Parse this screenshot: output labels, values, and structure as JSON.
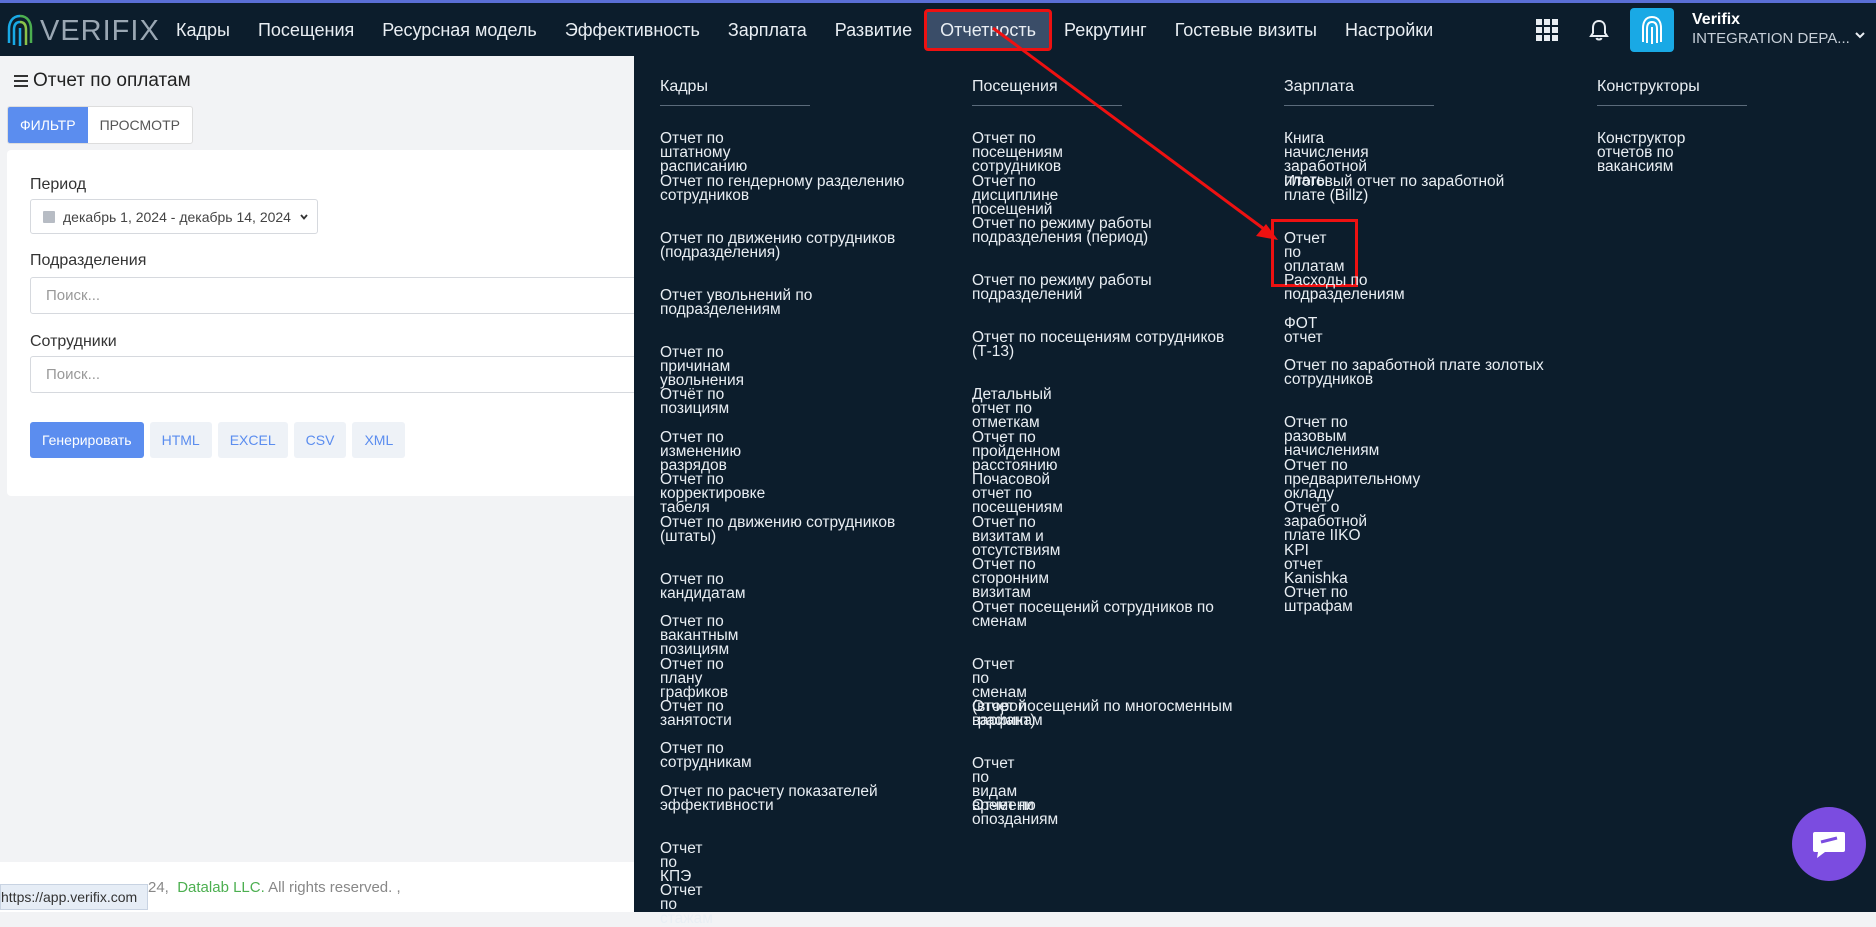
{
  "brand": {
    "logo_text": "VERIFIX"
  },
  "nav": [
    {
      "label": "Кадры"
    },
    {
      "label": "Посещения"
    },
    {
      "label": "Ресурсная модель"
    },
    {
      "label": "Эффективность"
    },
    {
      "label": "Зарплата"
    },
    {
      "label": "Развитие"
    },
    {
      "label": "Отчетность"
    },
    {
      "label": "Рекрутинг"
    },
    {
      "label": "Гостевые визиты"
    },
    {
      "label": "Настройки"
    }
  ],
  "user": {
    "name": "Verifix",
    "org": "INTEGRATION DEPA..."
  },
  "page": {
    "title": "Отчет по оплатам",
    "tabs": [
      {
        "label": "ФИЛЬТР"
      },
      {
        "label": "ПРОСМОТР"
      }
    ],
    "period_label": "Период",
    "period_value": "декабрь 1, 2024 - декабрь 14, 2024",
    "divisions_label": "Подразделения",
    "divisions_placeholder": "Поиск...",
    "employees_label": "Сотрудники",
    "employees_placeholder": "Поиск...",
    "buttons": [
      {
        "label": "Генерировать"
      },
      {
        "label": "HTML"
      },
      {
        "label": "EXCEL"
      },
      {
        "label": "CSV"
      },
      {
        "label": "XML"
      }
    ]
  },
  "footer": {
    "prefix": "24,",
    "company": "Datalab LLC.",
    "suffix": "All rights reserved. ,"
  },
  "status_url": "https://app.verifix.com",
  "menu": {
    "cadres": {
      "title": "Кадры",
      "items": [
        "Отчет по штатному расписанию",
        "Отчет по гендерному разделению сотрудников",
        "Отчет по движению сотрудников (подразделения)",
        "Отчет увольнений по подразделениям",
        "Отчет по причинам увольнения",
        "Отчёт по позициям",
        "Отчет по изменению разрядов",
        "Отчет по корректировке табеля",
        "Отчет по движению сотрудников (штаты)",
        "Отчет по кандидатам",
        "Отчет по вакантным позициям",
        "Отчет по плану графиков",
        "Отчет по занятости",
        "Отчет по сотрудникам",
        "Отчет по расчету показателей эффективности",
        "Отчет по КПЭ",
        "Отчет по стажам"
      ]
    },
    "visits": {
      "title": "Посещения",
      "items": [
        "Отчет по посещениям сотрудников",
        "Отчет по дисциплине посещений",
        "Отчет по режиму работы подразделения (период)",
        "Отчет по режиму работы подразделений",
        "Отчет по посещениям сотрудников (Т-13)",
        "Детальный отчет по отметкам",
        "Отчет по пройденном расстоянию",
        "Почасовой отчет по посещениям",
        "Отчет по визитам и отсутствиям",
        "Отчет по сторонним визитам",
        "Отчет посещений сотрудников по сменам",
        "Отчет по сменам (второй вариант)",
        "Отчет посещений по многосменным графикам",
        "Отчет по видам времени",
        "Отчет по опозданиям"
      ]
    },
    "salary": {
      "title": "Зарплата",
      "items": [
        "Книга начисления заработной платы",
        "Итоговый отчет по заработной плате (Billz)",
        "Отчет по оплатам",
        "Расходы по подразделениям",
        "ФОТ отчет",
        "Отчет по заработной плате золотых сотрудников",
        "Отчет по разовым начислениям",
        "Отчет по предварительному окладу",
        "Отчет о заработной плате IIKO",
        "KPI отчет Kanishka",
        "Отчет по штрафам"
      ]
    },
    "constructors": {
      "title": "Конструкторы",
      "items": [
        "Конструктор отчетов по вакансиям"
      ]
    }
  }
}
